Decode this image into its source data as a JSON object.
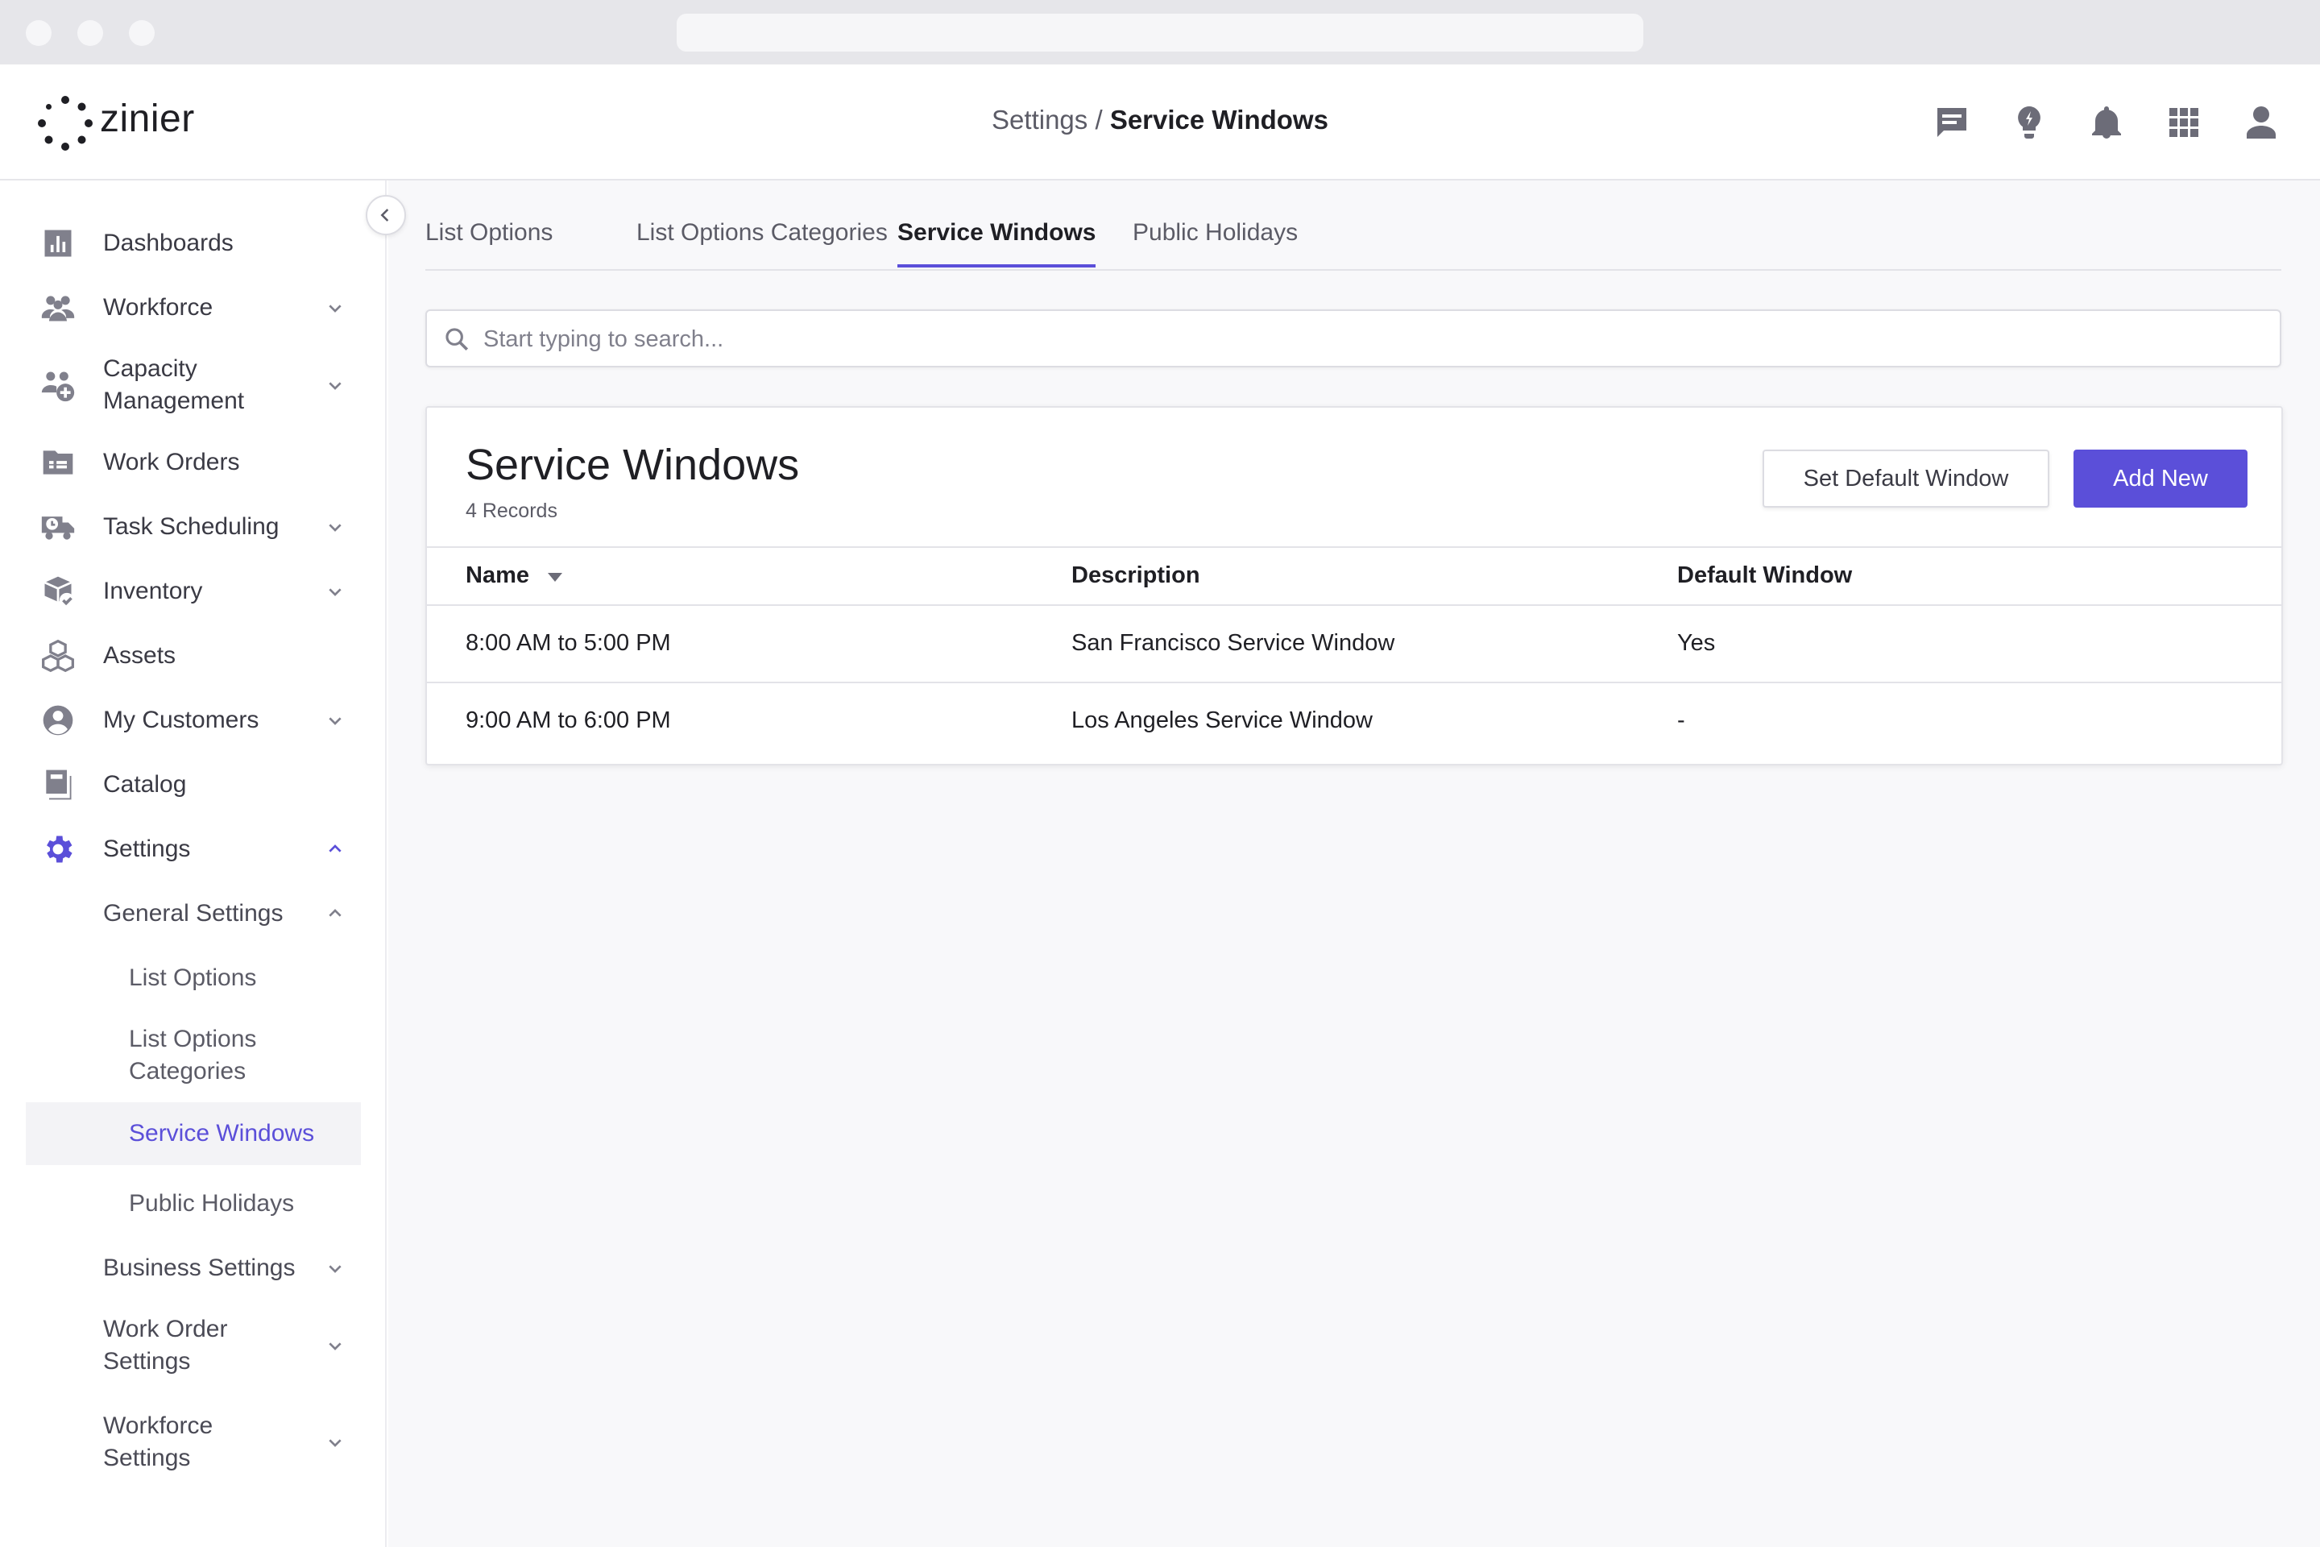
{
  "app": {
    "logo_text": "zinier"
  },
  "header": {
    "breadcrumb_parent": "Settings",
    "breadcrumb_sep": " / ",
    "breadcrumb_current": "Service Windows",
    "icons": [
      "chat-icon",
      "lightbulb-icon",
      "bell-icon",
      "apps-grid-icon",
      "user-icon"
    ]
  },
  "sidebar": {
    "items": [
      {
        "label": "Dashboards",
        "icon": "bar-chart-icon"
      },
      {
        "label": "Workforce",
        "icon": "people-icon"
      },
      {
        "label": "Capacity",
        "label2": "Management",
        "icon": "people-add-icon"
      },
      {
        "label": "Work Orders",
        "icon": "folder-list-icon"
      },
      {
        "label": "Task Scheduling",
        "icon": "truck-clock-icon"
      },
      {
        "label": "Inventory",
        "icon": "box-check-icon"
      },
      {
        "label": "Assets",
        "icon": "cubes-icon"
      },
      {
        "label": "My Customers",
        "icon": "account-circle-icon"
      },
      {
        "label": "Catalog",
        "icon": "book-icon"
      },
      {
        "label": "Settings",
        "icon": "gear-icon"
      }
    ],
    "general_settings": "General Settings",
    "sub_items": [
      {
        "label": "List Options"
      },
      {
        "label": "List Options",
        "label2": "Categories"
      },
      {
        "label": "Service Windows"
      },
      {
        "label": "Public Holidays"
      }
    ],
    "business_settings": "Business Settings",
    "work_order_settings": [
      "Work Order",
      "Settings"
    ],
    "workforce_settings": [
      "Workforce",
      "Settings"
    ]
  },
  "tabs": [
    "List Options",
    "List Options Categories",
    "Service Windows",
    "Public Holidays"
  ],
  "active_tab": "Service Windows",
  "search": {
    "placeholder": "Start typing to search..."
  },
  "card": {
    "title": "Service Windows",
    "records": "4 Records",
    "set_default_label": "Set Default Window",
    "add_new_label": "Add New"
  },
  "table": {
    "columns": [
      "Name",
      "Description",
      "Default Window"
    ],
    "rows": [
      [
        "8:00 AM to 5:00 PM",
        "San Francisco Service Window",
        "Yes"
      ],
      [
        "9:00 AM to 6:00 PM",
        "Los Angeles Service Window",
        "-"
      ]
    ]
  },
  "colors": {
    "accent": "#5b4fd9",
    "text": "#1f1f24",
    "muted": "#5b5b66"
  }
}
